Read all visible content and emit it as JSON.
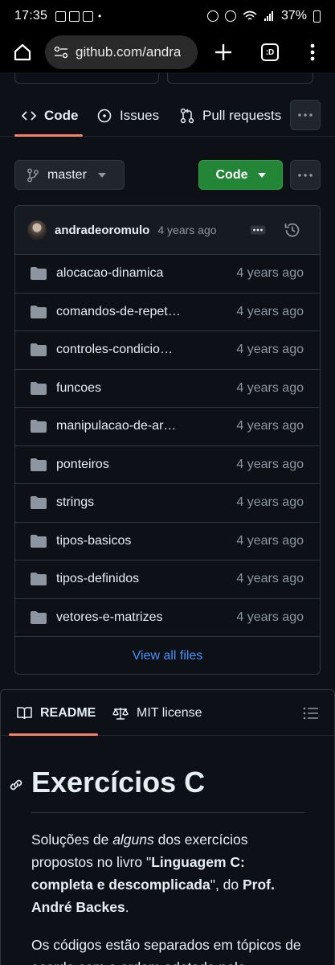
{
  "status_bar": {
    "time": "17:35",
    "dot": "•",
    "battery": "37%"
  },
  "browser": {
    "url": "github.com/andra",
    "tab_count": ":D"
  },
  "repo_nav": {
    "tabs": [
      {
        "label": "Code",
        "icon": "code-icon",
        "active": true
      },
      {
        "label": "Issues",
        "icon": "issue-opened-icon",
        "active": false
      },
      {
        "label": "Pull requests",
        "icon": "git-pull-request-icon",
        "active": false
      }
    ]
  },
  "branch": {
    "name": "master"
  },
  "code_button": {
    "label": "Code"
  },
  "latest_commit": {
    "user": "andradeoromulo",
    "time": "4 years ago"
  },
  "files": [
    {
      "name": "alocacao-dinamica",
      "time": "4 years ago"
    },
    {
      "name": "comandos-de-repet…",
      "time": "4 years ago"
    },
    {
      "name": "controles-condicio…",
      "time": "4 years ago"
    },
    {
      "name": "funcoes",
      "time": "4 years ago"
    },
    {
      "name": "manipulacao-de-ar…",
      "time": "4 years ago"
    },
    {
      "name": "ponteiros",
      "time": "4 years ago"
    },
    {
      "name": "strings",
      "time": "4 years ago"
    },
    {
      "name": "tipos-basicos",
      "time": "4 years ago"
    },
    {
      "name": "tipos-definidos",
      "time": "4 years ago"
    },
    {
      "name": "vetores-e-matrizes",
      "time": "4 years ago"
    }
  ],
  "view_all": "View all files",
  "readme": {
    "tabs": [
      {
        "label": "README",
        "icon": "book-icon",
        "active": true
      },
      {
        "label": "MIT license",
        "icon": "law-icon",
        "active": false
      }
    ],
    "title": "Exercícios C",
    "p1": {
      "a": "Soluções de ",
      "b": "alguns",
      "c": " dos exercícios propostos no livro \"",
      "d": "Linguagem C: completa e descomplicada",
      "e": "\", do ",
      "f": "Prof. André Backes",
      "g": "."
    },
    "p2": "Os códigos estão separados em tópicos de acordo com a ordem adotada pelo"
  },
  "colors": {
    "background": "#0d1117",
    "accent_underline": "#f78166",
    "primary_button": "#238636",
    "link": "#4493f8",
    "muted_text": "#8d96a0",
    "border": "#30363d"
  }
}
